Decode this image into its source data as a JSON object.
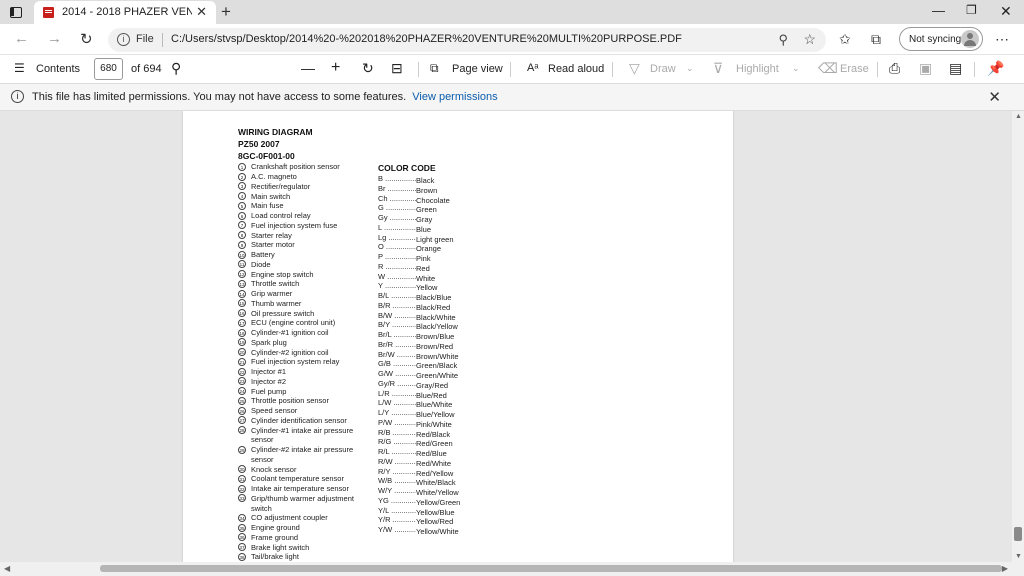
{
  "browser": {
    "tab_title": "2014 - 2018 PHAZER VENTURE M",
    "tab_close": "✕",
    "new_tab": "+",
    "file_label": "File",
    "url": "C:/Users/stvsp/Desktop/2014%20-%202018%20PHAZER%20VENTURE%20MULTI%20PURPOSE.PDF",
    "sync_label": "Not syncing"
  },
  "pdf_toolbar": {
    "contents_label": "Contents",
    "page_current": "680",
    "page_total": "of 694",
    "page_view_label": "Page view",
    "read_aloud_label": "Read aloud",
    "draw_label": "Draw",
    "highlight_label": "Highlight",
    "erase_label": "Erase"
  },
  "infobar": {
    "message": "This file has limited permissions. You may not have access to some features.",
    "link": "View permissions"
  },
  "document": {
    "title": "WIRING DIAGRAM",
    "model": "PZ50 2007",
    "code": "8GC-0F001-00",
    "legend": [
      {
        "n": "1",
        "text": "Crankshaft position sensor"
      },
      {
        "n": "2",
        "text": "A.C. magneto"
      },
      {
        "n": "3",
        "text": "Rectifier/regulator"
      },
      {
        "n": "4",
        "text": "Main switch"
      },
      {
        "n": "5",
        "text": "Main fuse"
      },
      {
        "n": "6",
        "text": "Load control relay"
      },
      {
        "n": "7",
        "text": "Fuel injection system fuse"
      },
      {
        "n": "8",
        "text": "Starter relay"
      },
      {
        "n": "9",
        "text": "Starter motor"
      },
      {
        "n": "10",
        "text": "Battery"
      },
      {
        "n": "11",
        "text": "Diode"
      },
      {
        "n": "12",
        "text": "Engine stop switch"
      },
      {
        "n": "13",
        "text": "Throttle switch"
      },
      {
        "n": "14",
        "text": "Grip warmer"
      },
      {
        "n": "15",
        "text": "Thumb warmer"
      },
      {
        "n": "16",
        "text": "Oil pressure switch"
      },
      {
        "n": "17",
        "text": "ECU (engine control unit)"
      },
      {
        "n": "18",
        "text": "Cylinder-#1 ignition coil"
      },
      {
        "n": "19",
        "text": "Spark plug"
      },
      {
        "n": "20",
        "text": "Cylinder-#2 ignition coil"
      },
      {
        "n": "21",
        "text": "Fuel injection system relay"
      },
      {
        "n": "22",
        "text": "Injector #1"
      },
      {
        "n": "23",
        "text": "Injector #2"
      },
      {
        "n": "24",
        "text": "Fuel pump"
      },
      {
        "n": "25",
        "text": "Throttle position sensor"
      },
      {
        "n": "26",
        "text": "Speed sensor"
      },
      {
        "n": "27",
        "text": "Cylinder identification sensor"
      },
      {
        "n": "28",
        "text": "Cylinder-#1 intake air pressure",
        "cont": "sensor"
      },
      {
        "n": "29",
        "text": "Cylinder-#2 intake air pressure",
        "cont": "sensor"
      },
      {
        "n": "30",
        "text": "Knock sensor"
      },
      {
        "n": "31",
        "text": "Coolant temperature sensor"
      },
      {
        "n": "32",
        "text": "Intake air temperature sensor"
      },
      {
        "n": "33",
        "text": "Grip/thumb warmer adjustment",
        "cont": "switch"
      },
      {
        "n": "34",
        "text": "CO adjustment coupler"
      },
      {
        "n": "35",
        "text": "Engine ground"
      },
      {
        "n": "36",
        "text": "Frame ground"
      },
      {
        "n": "37",
        "text": "Brake light switch"
      },
      {
        "n": "38",
        "text": "Tail/brake light"
      }
    ],
    "color_code_title": "COLOR CODE",
    "color_codes": [
      {
        "code": "B",
        "name": "Black"
      },
      {
        "code": "Br",
        "name": "Brown"
      },
      {
        "code": "Ch",
        "name": "Chocolate"
      },
      {
        "code": "G",
        "name": "Green"
      },
      {
        "code": "Gy",
        "name": "Gray"
      },
      {
        "code": "L",
        "name": "Blue"
      },
      {
        "code": "Lg",
        "name": "Light green"
      },
      {
        "code": "O",
        "name": "Orange"
      },
      {
        "code": "P",
        "name": "Pink"
      },
      {
        "code": "R",
        "name": "Red"
      },
      {
        "code": "W",
        "name": "White"
      },
      {
        "code": "Y",
        "name": "Yellow"
      },
      {
        "code": "B/L",
        "name": "Black/Blue"
      },
      {
        "code": "B/R",
        "name": "Black/Red"
      },
      {
        "code": "B/W",
        "name": "Black/White"
      },
      {
        "code": "B/Y",
        "name": "Black/Yellow"
      },
      {
        "code": "Br/L",
        "name": "Brown/Blue"
      },
      {
        "code": "Br/R",
        "name": "Brown/Red"
      },
      {
        "code": "Br/W",
        "name": "Brown/White"
      },
      {
        "code": "G/B",
        "name": "Green/Black"
      },
      {
        "code": "G/W",
        "name": "Green/White"
      },
      {
        "code": "Gy/R",
        "name": "Gray/Red"
      },
      {
        "code": "L/R",
        "name": "Blue/Red"
      },
      {
        "code": "L/W",
        "name": "Blue/White"
      },
      {
        "code": "L/Y",
        "name": "Blue/Yellow"
      },
      {
        "code": "P/W",
        "name": "Pink/White"
      },
      {
        "code": "R/B",
        "name": "Red/Black"
      },
      {
        "code": "R/G",
        "name": "Red/Green"
      },
      {
        "code": "R/L",
        "name": "Red/Blue"
      },
      {
        "code": "R/W",
        "name": "Red/White"
      },
      {
        "code": "R/Y",
        "name": "Red/Yellow"
      },
      {
        "code": "W/B",
        "name": "White/Black"
      },
      {
        "code": "W/Y",
        "name": "White/Yellow"
      },
      {
        "code": "YG",
        "name": "Yellow/Green"
      },
      {
        "code": "Y/L",
        "name": "Yellow/Blue"
      },
      {
        "code": "Y/R",
        "name": "Yellow/Red"
      },
      {
        "code": "Y/W",
        "name": "Yellow/White"
      }
    ]
  },
  "colors": {
    "link": "#0b5cad",
    "pdf_icon": "#c8211b"
  }
}
